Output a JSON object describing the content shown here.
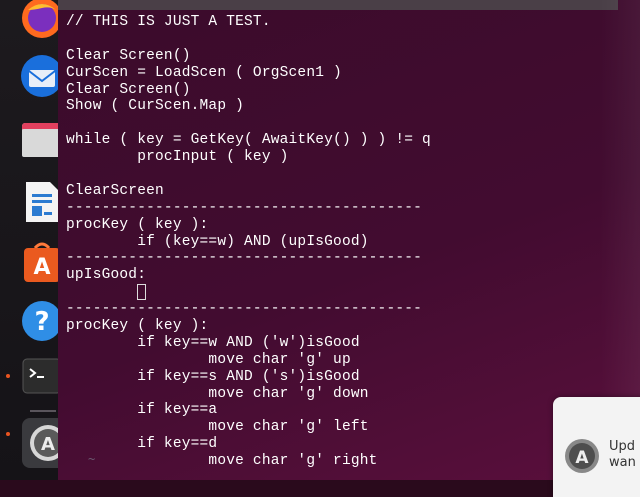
{
  "dock": {
    "items": [
      {
        "name": "firefox-icon"
      },
      {
        "name": "thunderbird-icon"
      },
      {
        "name": "files-icon"
      },
      {
        "name": "libreoffice-writer-icon"
      },
      {
        "name": "app-center-icon"
      },
      {
        "name": "help-icon"
      },
      {
        "name": "terminal-icon"
      },
      {
        "name": "software-updater-icon"
      }
    ]
  },
  "terminal": {
    "lines": [
      "// THIS IS JUST A TEST.",
      "",
      "Clear Screen()",
      "CurScen = LoadScen ( OrgScen1 )",
      "Clear Screen()",
      "Show ( CurScen.Map )",
      "",
      "while ( key = GetKey( AwaitKey() ) ) != q",
      "        procInput ( key )",
      "",
      "ClearScreen",
      "----------------------------------------",
      "procKey ( key ):",
      "        if (key==w) AND (upIsGood)",
      "----------------------------------------",
      "upIsGood:",
      "__CURSOR__",
      "----------------------------------------",
      "procKey ( key ):",
      "        if key==w AND ('w')isGood",
      "                move char 'g' up",
      "        if key==s AND ('s')isGood",
      "                move char 'g' down",
      "        if key==a",
      "                move char 'g' left",
      "        if key==d",
      "                move char 'g' right"
    ],
    "empty_line_marker": "~"
  },
  "notification": {
    "text_line1": "Upd",
    "text_line2": "wan"
  }
}
